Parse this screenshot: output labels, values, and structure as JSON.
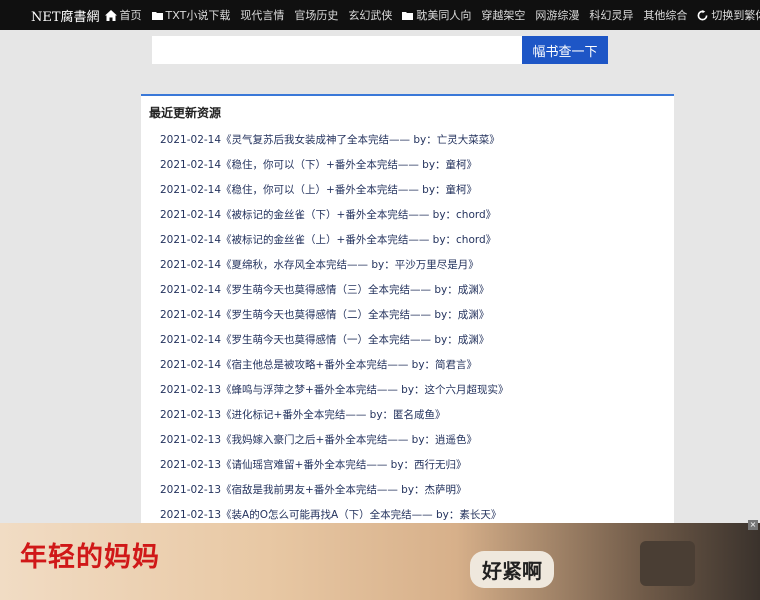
{
  "header": {
    "logo": "NET腐書網",
    "nav": [
      {
        "label": "首页",
        "icon": "home-icon"
      },
      {
        "label": "TXT小说下载",
        "icon": "folder-icon"
      },
      {
        "label": "现代言情"
      },
      {
        "label": "官场历史"
      },
      {
        "label": "玄幻武侠"
      },
      {
        "label": "耽美同人向",
        "icon": "folder-icon"
      },
      {
        "label": "穿越架空"
      },
      {
        "label": "网游综漫"
      },
      {
        "label": "科幻灵异"
      },
      {
        "label": "其他综合"
      },
      {
        "label": "切换到繁体",
        "icon": "refresh-icon"
      }
    ]
  },
  "search": {
    "placeholder": "",
    "button_label": "幅书查一下"
  },
  "recent": {
    "title": "最近更新资源",
    "items": [
      "2021-02-14《灵气复苏后我女装成神了全本完结—— by：亡灵大菜菜》",
      "2021-02-14《稳住，你可以（下）+番外全本完结—— by：童柯》",
      "2021-02-14《稳住，你可以（上）+番外全本完结—— by：童柯》",
      "2021-02-14《被标记的金丝雀（下）+番外全本完结—— by：chord》",
      "2021-02-14《被标记的金丝雀（上）+番外全本完结—— by：chord》",
      "2021-02-14《夏绵秋，水存风全本完结—— by：平沙万里尽是月》",
      "2021-02-14《罗生萌今天也莫得感情（三）全本完结—— by：成渊》",
      "2021-02-14《罗生萌今天也莫得感情（二）全本完结—— by：成渊》",
      "2021-02-14《罗生萌今天也莫得感情（一）全本完结—— by：成渊》",
      "2021-02-14《宿主他总是被攻略+番外全本完结—— by：简君言》",
      "2021-02-13《蜂鸣与浮萍之梦+番外全本完结—— by：这个六月超现实》",
      "2021-02-13《进化标记+番外全本完结—— by：匿名咸鱼》",
      "2021-02-13《我妈嫁入豪门之后+番外全本完结—— by：逍遥色》",
      "2021-02-13《请仙瑶宫难留+番外全本完结—— by：西行无归》",
      "2021-02-13《宿敌是我前男友+番外全本完结—— by：杰萨明》",
      "2021-02-13《装A的O怎么可能再找A（下）全本完结—— by：素长天》"
    ]
  },
  "ad": {
    "headline": "年轻的妈妈",
    "bubble": "好紧啊",
    "close_label": "×"
  }
}
